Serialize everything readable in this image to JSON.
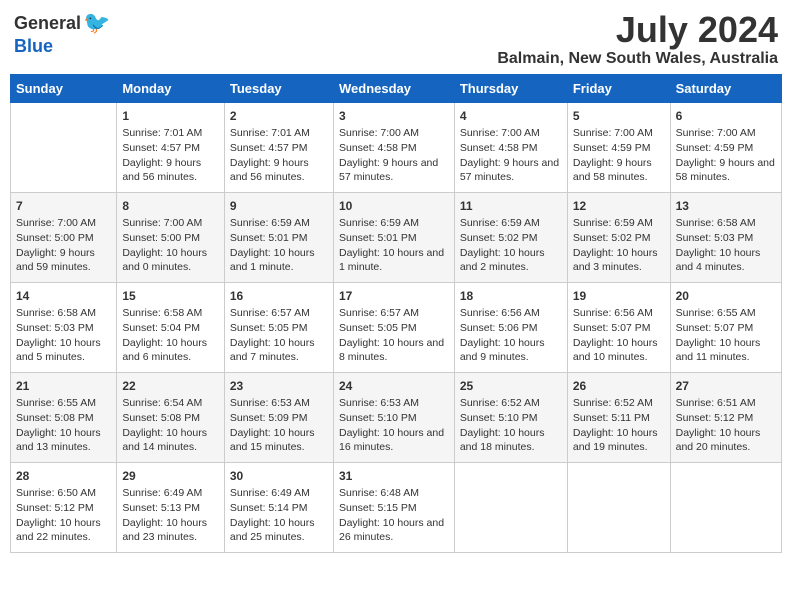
{
  "header": {
    "logo_general": "General",
    "logo_blue": "Blue",
    "title": "July 2024",
    "location": "Balmain, New South Wales, Australia"
  },
  "weekdays": [
    "Sunday",
    "Monday",
    "Tuesday",
    "Wednesday",
    "Thursday",
    "Friday",
    "Saturday"
  ],
  "weeks": [
    [
      {
        "day": "",
        "sunrise": "",
        "sunset": "",
        "daylight": ""
      },
      {
        "day": "1",
        "sunrise": "Sunrise: 7:01 AM",
        "sunset": "Sunset: 4:57 PM",
        "daylight": "Daylight: 9 hours and 56 minutes."
      },
      {
        "day": "2",
        "sunrise": "Sunrise: 7:01 AM",
        "sunset": "Sunset: 4:57 PM",
        "daylight": "Daylight: 9 hours and 56 minutes."
      },
      {
        "day": "3",
        "sunrise": "Sunrise: 7:00 AM",
        "sunset": "Sunset: 4:58 PM",
        "daylight": "Daylight: 9 hours and 57 minutes."
      },
      {
        "day": "4",
        "sunrise": "Sunrise: 7:00 AM",
        "sunset": "Sunset: 4:58 PM",
        "daylight": "Daylight: 9 hours and 57 minutes."
      },
      {
        "day": "5",
        "sunrise": "Sunrise: 7:00 AM",
        "sunset": "Sunset: 4:59 PM",
        "daylight": "Daylight: 9 hours and 58 minutes."
      },
      {
        "day": "6",
        "sunrise": "Sunrise: 7:00 AM",
        "sunset": "Sunset: 4:59 PM",
        "daylight": "Daylight: 9 hours and 58 minutes."
      }
    ],
    [
      {
        "day": "7",
        "sunrise": "Sunrise: 7:00 AM",
        "sunset": "Sunset: 5:00 PM",
        "daylight": "Daylight: 9 hours and 59 minutes."
      },
      {
        "day": "8",
        "sunrise": "Sunrise: 7:00 AM",
        "sunset": "Sunset: 5:00 PM",
        "daylight": "Daylight: 10 hours and 0 minutes."
      },
      {
        "day": "9",
        "sunrise": "Sunrise: 6:59 AM",
        "sunset": "Sunset: 5:01 PM",
        "daylight": "Daylight: 10 hours and 1 minute."
      },
      {
        "day": "10",
        "sunrise": "Sunrise: 6:59 AM",
        "sunset": "Sunset: 5:01 PM",
        "daylight": "Daylight: 10 hours and 1 minute."
      },
      {
        "day": "11",
        "sunrise": "Sunrise: 6:59 AM",
        "sunset": "Sunset: 5:02 PM",
        "daylight": "Daylight: 10 hours and 2 minutes."
      },
      {
        "day": "12",
        "sunrise": "Sunrise: 6:59 AM",
        "sunset": "Sunset: 5:02 PM",
        "daylight": "Daylight: 10 hours and 3 minutes."
      },
      {
        "day": "13",
        "sunrise": "Sunrise: 6:58 AM",
        "sunset": "Sunset: 5:03 PM",
        "daylight": "Daylight: 10 hours and 4 minutes."
      }
    ],
    [
      {
        "day": "14",
        "sunrise": "Sunrise: 6:58 AM",
        "sunset": "Sunset: 5:03 PM",
        "daylight": "Daylight: 10 hours and 5 minutes."
      },
      {
        "day": "15",
        "sunrise": "Sunrise: 6:58 AM",
        "sunset": "Sunset: 5:04 PM",
        "daylight": "Daylight: 10 hours and 6 minutes."
      },
      {
        "day": "16",
        "sunrise": "Sunrise: 6:57 AM",
        "sunset": "Sunset: 5:05 PM",
        "daylight": "Daylight: 10 hours and 7 minutes."
      },
      {
        "day": "17",
        "sunrise": "Sunrise: 6:57 AM",
        "sunset": "Sunset: 5:05 PM",
        "daylight": "Daylight: 10 hours and 8 minutes."
      },
      {
        "day": "18",
        "sunrise": "Sunrise: 6:56 AM",
        "sunset": "Sunset: 5:06 PM",
        "daylight": "Daylight: 10 hours and 9 minutes."
      },
      {
        "day": "19",
        "sunrise": "Sunrise: 6:56 AM",
        "sunset": "Sunset: 5:07 PM",
        "daylight": "Daylight: 10 hours and 10 minutes."
      },
      {
        "day": "20",
        "sunrise": "Sunrise: 6:55 AM",
        "sunset": "Sunset: 5:07 PM",
        "daylight": "Daylight: 10 hours and 11 minutes."
      }
    ],
    [
      {
        "day": "21",
        "sunrise": "Sunrise: 6:55 AM",
        "sunset": "Sunset: 5:08 PM",
        "daylight": "Daylight: 10 hours and 13 minutes."
      },
      {
        "day": "22",
        "sunrise": "Sunrise: 6:54 AM",
        "sunset": "Sunset: 5:08 PM",
        "daylight": "Daylight: 10 hours and 14 minutes."
      },
      {
        "day": "23",
        "sunrise": "Sunrise: 6:53 AM",
        "sunset": "Sunset: 5:09 PM",
        "daylight": "Daylight: 10 hours and 15 minutes."
      },
      {
        "day": "24",
        "sunrise": "Sunrise: 6:53 AM",
        "sunset": "Sunset: 5:10 PM",
        "daylight": "Daylight: 10 hours and 16 minutes."
      },
      {
        "day": "25",
        "sunrise": "Sunrise: 6:52 AM",
        "sunset": "Sunset: 5:10 PM",
        "daylight": "Daylight: 10 hours and 18 minutes."
      },
      {
        "day": "26",
        "sunrise": "Sunrise: 6:52 AM",
        "sunset": "Sunset: 5:11 PM",
        "daylight": "Daylight: 10 hours and 19 minutes."
      },
      {
        "day": "27",
        "sunrise": "Sunrise: 6:51 AM",
        "sunset": "Sunset: 5:12 PM",
        "daylight": "Daylight: 10 hours and 20 minutes."
      }
    ],
    [
      {
        "day": "28",
        "sunrise": "Sunrise: 6:50 AM",
        "sunset": "Sunset: 5:12 PM",
        "daylight": "Daylight: 10 hours and 22 minutes."
      },
      {
        "day": "29",
        "sunrise": "Sunrise: 6:49 AM",
        "sunset": "Sunset: 5:13 PM",
        "daylight": "Daylight: 10 hours and 23 minutes."
      },
      {
        "day": "30",
        "sunrise": "Sunrise: 6:49 AM",
        "sunset": "Sunset: 5:14 PM",
        "daylight": "Daylight: 10 hours and 25 minutes."
      },
      {
        "day": "31",
        "sunrise": "Sunrise: 6:48 AM",
        "sunset": "Sunset: 5:15 PM",
        "daylight": "Daylight: 10 hours and 26 minutes."
      },
      {
        "day": "",
        "sunrise": "",
        "sunset": "",
        "daylight": ""
      },
      {
        "day": "",
        "sunrise": "",
        "sunset": "",
        "daylight": ""
      },
      {
        "day": "",
        "sunrise": "",
        "sunset": "",
        "daylight": ""
      }
    ]
  ]
}
